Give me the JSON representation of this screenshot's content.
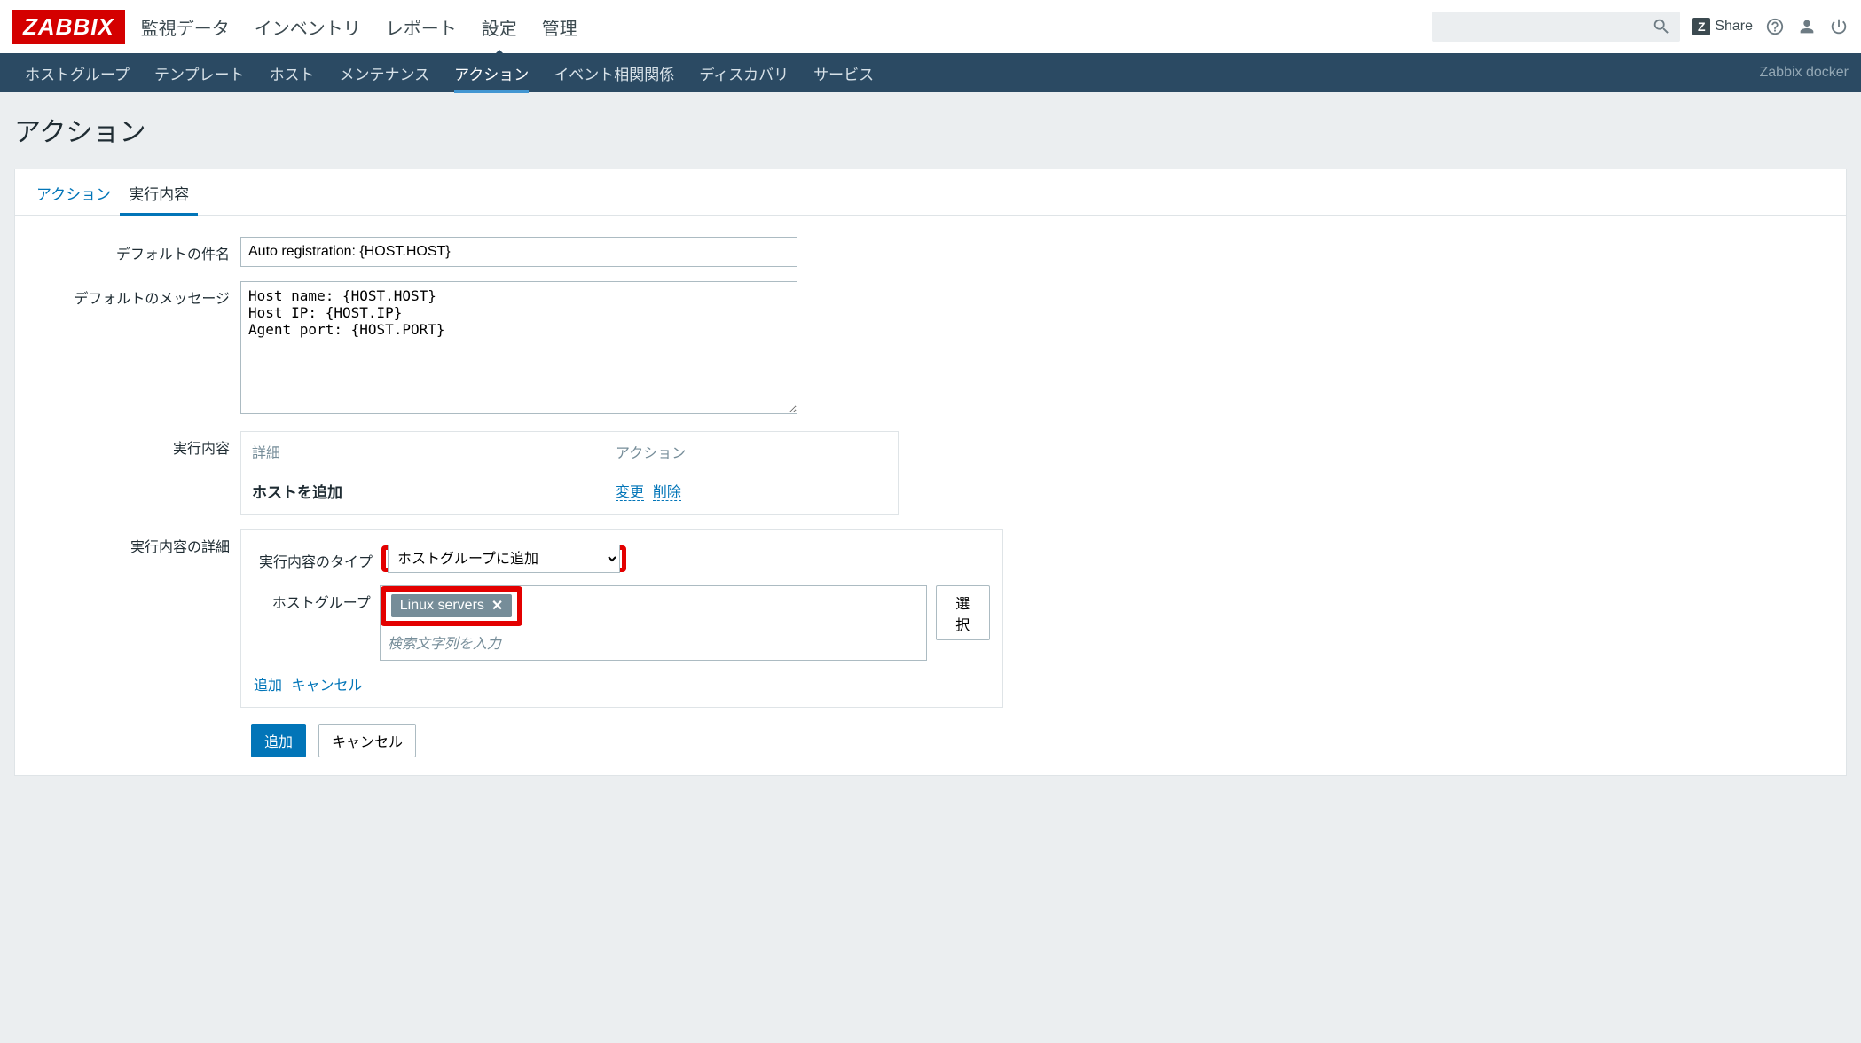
{
  "brand": "ZABBIX",
  "topnav": {
    "items": [
      "監視データ",
      "インベントリ",
      "レポート",
      "設定",
      "管理"
    ],
    "active_index": 3
  },
  "topRight": {
    "share_label": "Share"
  },
  "subnav": {
    "items": [
      "ホストグループ",
      "テンプレート",
      "ホスト",
      "メンテナンス",
      "アクション",
      "イベント相関関係",
      "ディスカバリ",
      "サービス"
    ],
    "active_index": 4,
    "right_text": "Zabbix docker"
  },
  "page_title": "アクション",
  "tabs": {
    "items": [
      "アクション",
      "実行内容"
    ],
    "active_index": 1
  },
  "form": {
    "subject_label": "デフォルトの件名",
    "subject_value": "Auto registration: {HOST.HOST}",
    "message_label": "デフォルトのメッセージ",
    "message_value": "Host name: {HOST.HOST}\nHost IP: {HOST.IP}\nAgent port: {HOST.PORT}",
    "operations_label": "実行内容",
    "operations_table": {
      "col_detail": "詳細",
      "col_action": "アクション",
      "row_detail": "ホストを追加",
      "action_edit": "変更",
      "action_delete": "削除"
    },
    "details_label": "実行内容の詳細",
    "details": {
      "type_label": "実行内容のタイプ",
      "type_value": "ホストグループに追加",
      "hostgroup_label": "ホストグループ",
      "hostgroup_tag": "Linux servers",
      "hostgroup_placeholder": "検索文字列を入力",
      "select_button": "選択",
      "add_link": "追加",
      "cancel_link": "キャンセル"
    },
    "submit_button": "追加",
    "cancel_button": "キャンセル"
  }
}
